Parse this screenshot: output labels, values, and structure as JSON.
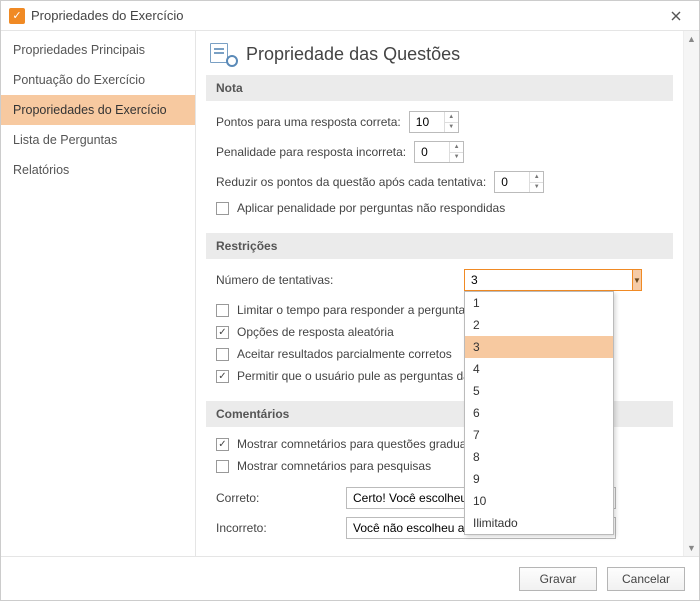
{
  "window": {
    "title": "Propriedades do Exercício"
  },
  "sidebar": {
    "items": [
      {
        "label": "Propriedades Principais"
      },
      {
        "label": "Pontuação do Exercício"
      },
      {
        "label": "Proporiedades do Exercício"
      },
      {
        "label": "Lista de Perguntas"
      },
      {
        "label": "Relatórios"
      }
    ],
    "selected_index": 2
  },
  "page": {
    "title": "Propriedade das Questões"
  },
  "sections": {
    "nota": {
      "title": "Nota",
      "points_label": "Pontos para uma resposta correta:",
      "points_value": "10",
      "penalty_label": "Penalidade para resposta incorreta:",
      "penalty_value": "0",
      "reduce_label": "Reduzir os pontos da questão após cada tentativa:",
      "reduce_value": "0",
      "apply_penalty_checkbox": "Aplicar penalidade por perguntas não respondidas",
      "apply_penalty_checked": false
    },
    "restricoes": {
      "title": "Restrições",
      "attempts_label": "Número de tentativas:",
      "attempts_value": "3",
      "attempts_options": [
        "1",
        "2",
        "3",
        "4",
        "5",
        "6",
        "7",
        "8",
        "9",
        "10",
        "Ilimitado"
      ],
      "limit_time": {
        "label": "Limitar o tempo para responder a pergunta:",
        "checked": false
      },
      "random_options": {
        "label": "Opções de resposta aleatória",
        "checked": true
      },
      "accept_partial": {
        "label": "Aceitar resultados parcialmente corretos",
        "checked": false
      },
      "allow_skip": {
        "label": "Permitir que o usuário pule as perguntas da pesquisa",
        "checked": true
      }
    },
    "comentarios": {
      "title": "Comentários",
      "show_graded": {
        "label": "Mostrar comnetários para questões graduadas",
        "checked": true
      },
      "show_survey": {
        "label": "Mostrar comnetários para pesquisas",
        "checked": false
      },
      "correct_label": "Correto:",
      "correct_value": "Certo! Você escolheu a resposta certa.",
      "incorrect_label": "Incorreto:",
      "incorrect_value": "Você não escolheu a resposta correta."
    }
  },
  "footer": {
    "save": "Gravar",
    "cancel": "Cancelar"
  }
}
